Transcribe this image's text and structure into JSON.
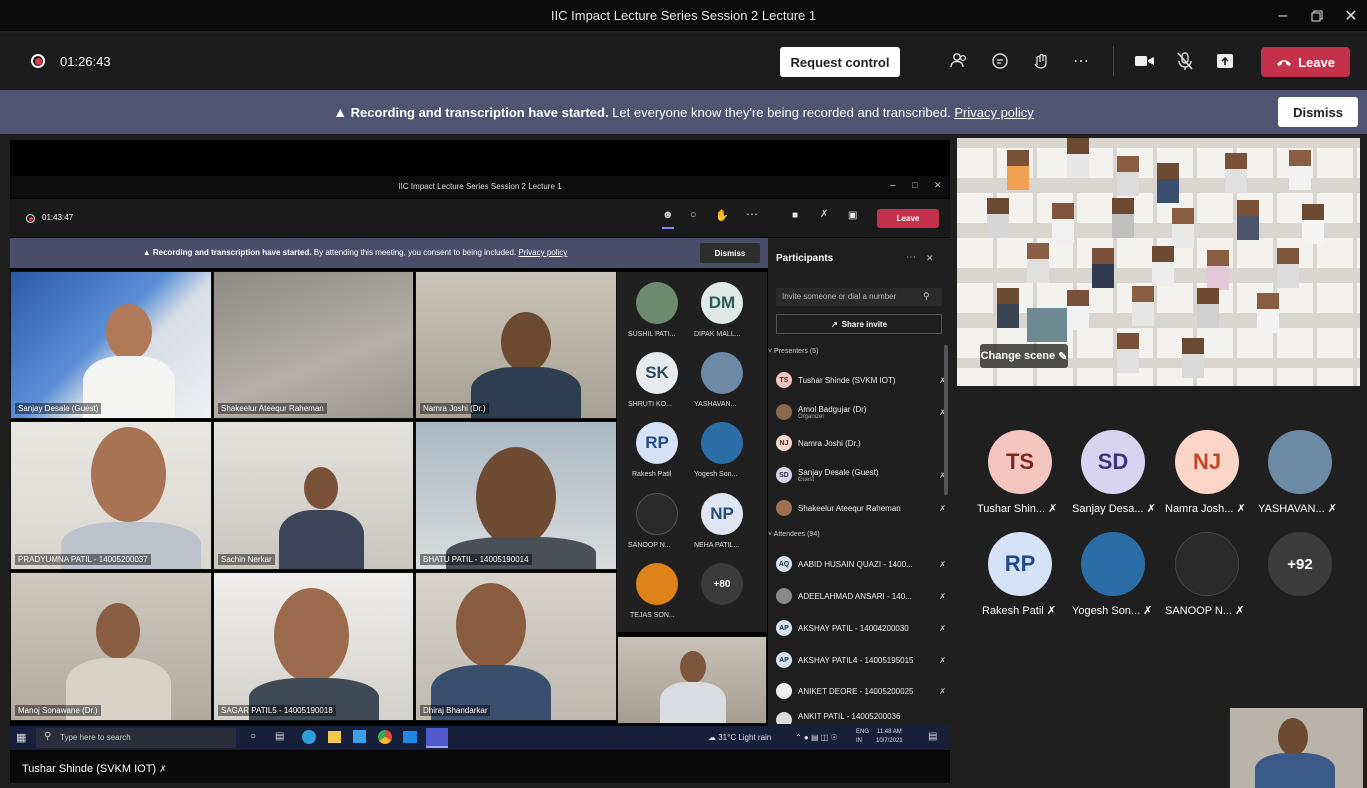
{
  "window": {
    "title": "IIC Impact Lecture Series Session 2 Lecture 1"
  },
  "toolbar": {
    "timer": "01:26:43",
    "request_control": "Request control",
    "leave": "Leave"
  },
  "banner": {
    "bold": "Recording and transcription have started.",
    "text": "Let everyone know they're being recorded and transcribed.",
    "link": "Privacy policy",
    "dismiss": "Dismiss"
  },
  "inner": {
    "title": "IIC Impact Lecture Series Session 2 Lecture 1",
    "timer": "01:43:47",
    "leave": "Leave",
    "banner_bold": "Recording and transcription have started.",
    "banner_text": "By attending this meeting, you consent to being included.",
    "banner_link": "Privacy policy",
    "dismiss": "Dismiss",
    "tiles": [
      "Sanjay Desale (Guest)",
      "Shakeelur Ateequr Raheman",
      "Namra Joshi (Dr.)",
      "PRADYUMNA PATIL - 14005200037",
      "Sachin Nerkar",
      "BHATU PATIL - 14005190014",
      "Manoj Sonawane (Dr.)",
      "SAGAR PATIL5 - 14005190018",
      "Dhiraj Bhandarkar"
    ],
    "small": [
      {
        "initials": "",
        "label": "SUSHIL PATI..."
      },
      {
        "initials": "DM",
        "label": "DIPAK MALL..."
      },
      {
        "initials": "SK",
        "label": "SHRUTI KO..."
      },
      {
        "initials": "",
        "label": "YASHAVAN..."
      },
      {
        "initials": "RP",
        "label": "Rakesh Patil"
      },
      {
        "initials": "",
        "label": "Yogesh Son..."
      },
      {
        "initials": "",
        "label": "SANOOP N..."
      },
      {
        "initials": "NP",
        "label": "NEHA PATIL..."
      },
      {
        "initials": "",
        "label": "TEJAS SON..."
      },
      {
        "initials": "+80",
        "label": ""
      }
    ],
    "participants": {
      "header": "Participants",
      "invite_placeholder": "Invite someone or dial a number",
      "share_invite": "Share invite",
      "presenters_header": "Presenters (5)",
      "presenters": [
        {
          "initials": "TS",
          "name": "Tushar Shinde (SVKM IOT)",
          "sub": ""
        },
        {
          "initials": "",
          "name": "Amol Badgujar (Dr)",
          "sub": "Organizer"
        },
        {
          "initials": "NJ",
          "name": "Namra Joshi (Dr.)",
          "sub": ""
        },
        {
          "initials": "SD",
          "name": "Sanjay Desale (Guest)",
          "sub": "Guest"
        },
        {
          "initials": "",
          "name": "Shakeelur Ateequr Raheman",
          "sub": ""
        }
      ],
      "attendees_header": "Attendees (94)",
      "attendees": [
        {
          "initials": "AQ",
          "name": "AABID HUSAIN QUAZI - 1400..."
        },
        {
          "initials": "",
          "name": "ADEELAHMAD ANSARI - 140..."
        },
        {
          "initials": "AP",
          "name": "AKSHAY PATIL - 14004200030"
        },
        {
          "initials": "AP",
          "name": "AKSHAY PATIL4 - 14005195015"
        },
        {
          "initials": "",
          "name": "ANIKET DEORE - 14005200025"
        },
        {
          "initials": "",
          "name": "ANKIT PATIL - 14005200036"
        }
      ]
    },
    "taskbar": {
      "search": "Type here to search",
      "weather": "31°C  Light rain",
      "lang": "ENG",
      "region": "IN",
      "time": "11:48 AM",
      "date": "10/7/2021"
    },
    "bottom_name": "Tushar Shinde (SVKM IOT)"
  },
  "right": {
    "change_scene": "Change scene",
    "people": [
      {
        "initials": "TS",
        "label": "Tushar Shin...",
        "color": "#f5c6c0",
        "text": "#7a2a22"
      },
      {
        "initials": "SD",
        "label": "Sanjay Desa...",
        "color": "#d9d3f2",
        "text": "#3e3478"
      },
      {
        "initials": "NJ",
        "label": "Namra Josh...",
        "color": "#fbd5c8",
        "text": "#c2462a"
      },
      {
        "initials": "",
        "label": "YASHAVAN...",
        "color": "#6d8aa5",
        "text": "#fff"
      },
      {
        "initials": "RP",
        "label": "Rakesh Patil",
        "color": "#d6e2f5",
        "text": "#1f4b8e"
      },
      {
        "initials": "",
        "label": "Yogesh Son...",
        "color": "#2b6ea7",
        "text": "#fff"
      },
      {
        "initials": "",
        "label": "SANOOP N...",
        "color": "#2a2a2a",
        "text": "#fff"
      },
      {
        "initials": "+92",
        "label": "",
        "color": "#3b3b3b",
        "text": "#fff"
      }
    ]
  }
}
